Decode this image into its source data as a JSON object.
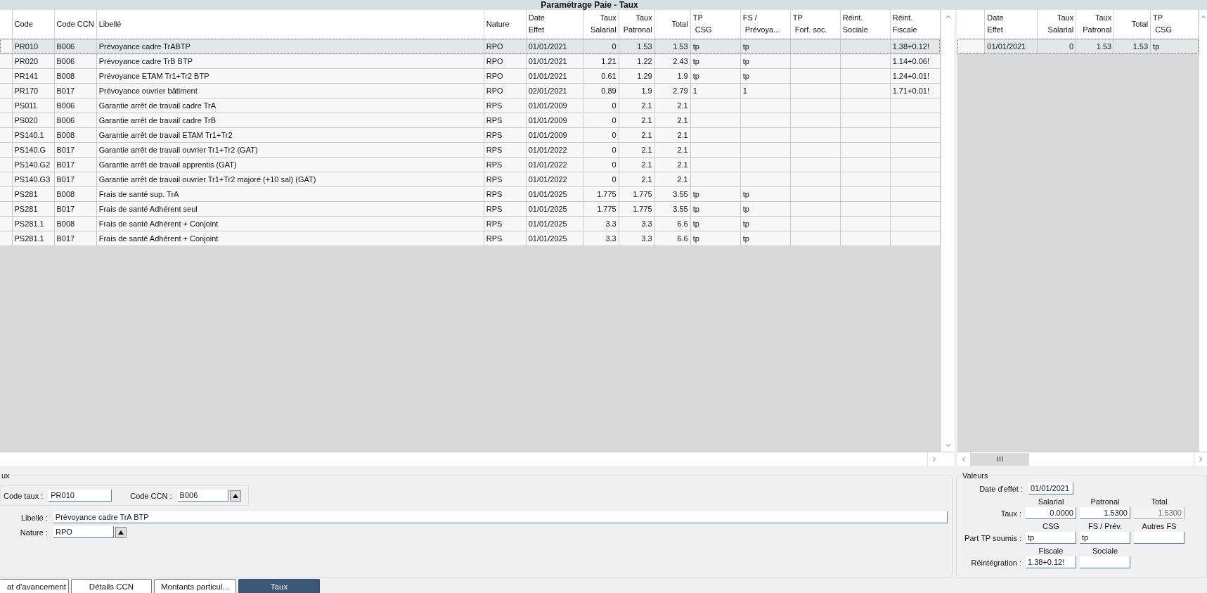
{
  "window": {
    "title": "Paramétrage Paie - Taux"
  },
  "table": {
    "columns": [
      "Code",
      "Code CCN",
      "Libellé",
      "Nature",
      "Date\nEffet",
      "Taux\nSalarial",
      "Taux\nPatronal",
      "Total",
      "TP\n CSG",
      "FS /\n Prévoya...",
      "TP\n Forf. soc.",
      "Réint.\nSociale",
      "Réint.\nFiscale"
    ],
    "rows": [
      {
        "selected": true,
        "code": "PR010",
        "code_ccn": "B006",
        "libelle": "Prévoyance cadre TrABTP",
        "nature": "RPO",
        "date_effet": "01/01/2021",
        "taux_salarial": "0",
        "taux_patronal": "1.53",
        "total": "1.53",
        "tp_csg": "tp",
        "fs_prevoyance": "tp",
        "reint_fiscale": "1.38+0.12!"
      },
      {
        "selected": false,
        "code": "PR020",
        "code_ccn": "B006",
        "libelle": "Prévoyance cadre TrB BTP",
        "nature": "RPO",
        "date_effet": "01/01/2021",
        "taux_salarial": "1.21",
        "taux_patronal": "1.22",
        "total": "2.43",
        "tp_csg": "tp",
        "fs_prevoyance": "tp",
        "reint_fiscale": "1.14+0.06!"
      },
      {
        "selected": false,
        "code": "PR141",
        "code_ccn": "B008",
        "libelle": "Prévoyance ETAM Tr1+Tr2 BTP",
        "nature": "RPO",
        "date_effet": "01/01/2021",
        "taux_salarial": "0.61",
        "taux_patronal": "1.29",
        "total": "1.9",
        "tp_csg": "tp",
        "fs_prevoyance": "tp",
        "reint_fiscale": "1.24+0.01!"
      },
      {
        "selected": false,
        "code": "PR170",
        "code_ccn": "B017",
        "libelle": "Prévoyance ouvrier bâtiment",
        "nature": "RPO",
        "date_effet": "02/01/2021",
        "taux_salarial": "0.89",
        "taux_patronal": "1.9",
        "total": "2.79",
        "tp_csg": "1",
        "fs_prevoyance": "1",
        "reint_fiscale": "1.71+0.01!"
      },
      {
        "selected": false,
        "code": "PS011",
        "code_ccn": "B006",
        "libelle": "Garantie arrêt de travail cadre TrA",
        "nature": "RPS",
        "date_effet": "01/01/2009",
        "taux_salarial": "0",
        "taux_patronal": "2.1",
        "total": "2.1"
      },
      {
        "selected": false,
        "code": "PS020",
        "code_ccn": "B006",
        "libelle": "Garantie arrêt de travail cadre TrB",
        "nature": "RPS",
        "date_effet": "01/01/2009",
        "taux_salarial": "0",
        "taux_patronal": "2.1",
        "total": "2.1"
      },
      {
        "selected": false,
        "code": "PS140.1",
        "code_ccn": "B008",
        "libelle": "Garantie arrêt de travail ETAM Tr1+Tr2",
        "nature": "RPS",
        "date_effet": "01/01/2009",
        "taux_salarial": "0",
        "taux_patronal": "2.1",
        "total": "2.1"
      },
      {
        "selected": false,
        "code": "PS140.G",
        "code_ccn": "B017",
        "libelle": "Garantie arrêt de travail ouvrier Tr1+Tr2 (GAT)",
        "nature": "RPS",
        "date_effet": "01/01/2022",
        "taux_salarial": "0",
        "taux_patronal": "2.1",
        "total": "2.1"
      },
      {
        "selected": false,
        "code": "PS140.G2",
        "code_ccn": "B017",
        "libelle": "Garantie arrêt de travail apprentis (GAT)",
        "nature": "RPS",
        "date_effet": "01/01/2022",
        "taux_salarial": "0",
        "taux_patronal": "2.1",
        "total": "2.1"
      },
      {
        "selected": false,
        "code": "PS140.G3",
        "code_ccn": "B017",
        "libelle": "Garantie arrêt de travail ouvrier Tr1+Tr2  majoré (+10 sal) (GAT)",
        "nature": "RPS",
        "date_effet": "01/01/2022",
        "taux_salarial": "0",
        "taux_patronal": "2.1",
        "total": "2.1"
      },
      {
        "selected": false,
        "code": "PS281",
        "code_ccn": "B008",
        "libelle": "Frais de santé sup. TrA",
        "nature": "RPS",
        "date_effet": "01/01/2025",
        "taux_salarial": "1.775",
        "taux_patronal": "1.775",
        "total": "3.55",
        "tp_csg": "tp",
        "fs_prevoyance": "tp"
      },
      {
        "selected": false,
        "code": "PS281",
        "code_ccn": "B017",
        "libelle": "Frais de santé Adhérent seul",
        "nature": "RPS",
        "date_effet": "01/01/2025",
        "taux_salarial": "1.775",
        "taux_patronal": "1.775",
        "total": "3.55",
        "tp_csg": "tp",
        "fs_prevoyance": "tp"
      },
      {
        "selected": false,
        "code": "PS281.1",
        "code_ccn": "B008",
        "libelle": "Frais de santé Adhérent + Conjoint",
        "nature": "RPS",
        "date_effet": "01/01/2025",
        "taux_salarial": "3.3",
        "taux_patronal": "3.3",
        "total": "6.6",
        "tp_csg": "tp",
        "fs_prevoyance": "tp"
      },
      {
        "selected": false,
        "code": "PS281.1",
        "code_ccn": "B017",
        "libelle": "Frais de santé Adhérent + Conjoint",
        "nature": "RPS",
        "date_effet": "01/01/2025",
        "taux_salarial": "3.3",
        "taux_patronal": "3.3",
        "total": "6.6",
        "tp_csg": "tp",
        "fs_prevoyance": "tp"
      }
    ]
  },
  "detail_table": {
    "columns": [
      "Date\nEffet",
      "Taux\nSalarial",
      "Taux\nPatronal",
      "Total",
      "TP\n CSG"
    ],
    "rows": [
      {
        "selected": true,
        "date_effet": "01/01/2021",
        "taux_salarial": "0",
        "taux_patronal": "1.53",
        "total": "1.53",
        "tp_csg": "tp"
      }
    ]
  },
  "form": {
    "legend": "ux",
    "code_taux": {
      "label": "Code taux :",
      "value": "PR010"
    },
    "code_ccn": {
      "label": "Code CCN :",
      "value": "B006"
    },
    "libelle": {
      "label": "Libellé :",
      "value": "Prévoyance cadre TrA BTP"
    },
    "nature": {
      "label": "Nature :",
      "value": "RPO"
    }
  },
  "values": {
    "legend": "Valeurs",
    "date_effet": {
      "label": "Date d'effet :",
      "value": "01/01/2021"
    },
    "rows": [
      {
        "label": "Taux :",
        "kind": "numeric",
        "fields": [
          {
            "header": "Salarial",
            "value": "0.0000",
            "disabled": false
          },
          {
            "header": "Patronal",
            "value": "1.5300",
            "disabled": false
          },
          {
            "header": "Total",
            "value": "1.5300",
            "disabled": true
          }
        ]
      },
      {
        "label": "Part TP soumis  :",
        "kind": "text",
        "fields": [
          {
            "header": "CSG",
            "value": "tp",
            "disabled": false
          },
          {
            "header": "FS / Prév.",
            "value": "tp",
            "disabled": false
          },
          {
            "header": "Autres FS",
            "disabled": false
          }
        ]
      },
      {
        "label": "Réintégration :",
        "kind": "text",
        "fields": [
          {
            "header": "Fiscale",
            "value": "1.38+0.12!",
            "disabled": false
          },
          {
            "header": "Sociale",
            "disabled": false
          }
        ]
      }
    ]
  },
  "tabs": [
    {
      "label": "at d'avancement",
      "selected": false
    },
    {
      "label": "Détails CCN",
      "selected": false
    },
    {
      "label": "Montants particul...",
      "selected": false
    },
    {
      "label": "Taux",
      "selected": true
    }
  ]
}
